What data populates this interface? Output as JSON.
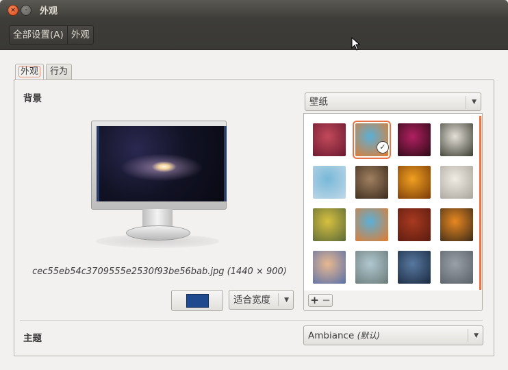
{
  "window": {
    "title": "外观",
    "close_glyph": "×",
    "minimize_glyph": "–"
  },
  "toolbar": {
    "breadcrumbs": [
      "全部设置(A)",
      "外观"
    ]
  },
  "tabs": [
    {
      "label": "外观",
      "active": true
    },
    {
      "label": "行为",
      "active": false
    }
  ],
  "background": {
    "label": "背景",
    "source_select": "壁纸",
    "filename": "cec55eb54c3709555e2530f93be56bab.jpg (1440 × 900)",
    "color": "#1f4a8e",
    "placement_select": "适合宽度"
  },
  "wallpapers": [
    {
      "name": "red-blur",
      "colors": [
        "#c24a5a",
        "#6a1830"
      ]
    },
    {
      "name": "cartoon-blue",
      "colors": [
        "#5ab0d8",
        "#e67a2a"
      ],
      "selected": true
    },
    {
      "name": "magenta-flower",
      "colors": [
        "#b02060",
        "#2a0a14"
      ]
    },
    {
      "name": "white-blossom",
      "colors": [
        "#e4e0d8",
        "#3a3c30"
      ]
    },
    {
      "name": "blue-sky-blossom",
      "colors": [
        "#78b8d8",
        "#c0d8e8"
      ]
    },
    {
      "name": "brown-bokeh",
      "colors": [
        "#a08060",
        "#3a2a1c"
      ]
    },
    {
      "name": "orange-flower",
      "colors": [
        "#f0a020",
        "#7a3a08"
      ]
    },
    {
      "name": "white-dial",
      "colors": [
        "#f0ece4",
        "#a8a49c"
      ]
    },
    {
      "name": "yellow-flower",
      "colors": [
        "#d8c040",
        "#5a6a38"
      ]
    },
    {
      "name": "cartoon-blue-2",
      "colors": [
        "#5ab0d8",
        "#e67a2a"
      ]
    },
    {
      "name": "red-leaf",
      "colors": [
        "#a83a20",
        "#5a1a10"
      ]
    },
    {
      "name": "orange-circle",
      "colors": [
        "#e88820",
        "#3a2a18"
      ]
    },
    {
      "name": "sunset-city",
      "colors": [
        "#e8b890",
        "#5870a8"
      ]
    },
    {
      "name": "rope",
      "colors": [
        "#b0c8d0",
        "#6a7a78"
      ]
    },
    {
      "name": "blue-tiles",
      "colors": [
        "#5878a0",
        "#1a2a40"
      ]
    },
    {
      "name": "grey-grass",
      "colors": [
        "#98a0a8",
        "#5a6068"
      ]
    }
  ],
  "wallpaper_buttons": {
    "add": "+",
    "remove": "−"
  },
  "theme": {
    "label": "主题",
    "select": "Ambiance",
    "select_note": "(默认)"
  },
  "icons": {
    "selected_check": "✓",
    "dropdown_arrow": "▼"
  },
  "accent_color": "#e8734a"
}
